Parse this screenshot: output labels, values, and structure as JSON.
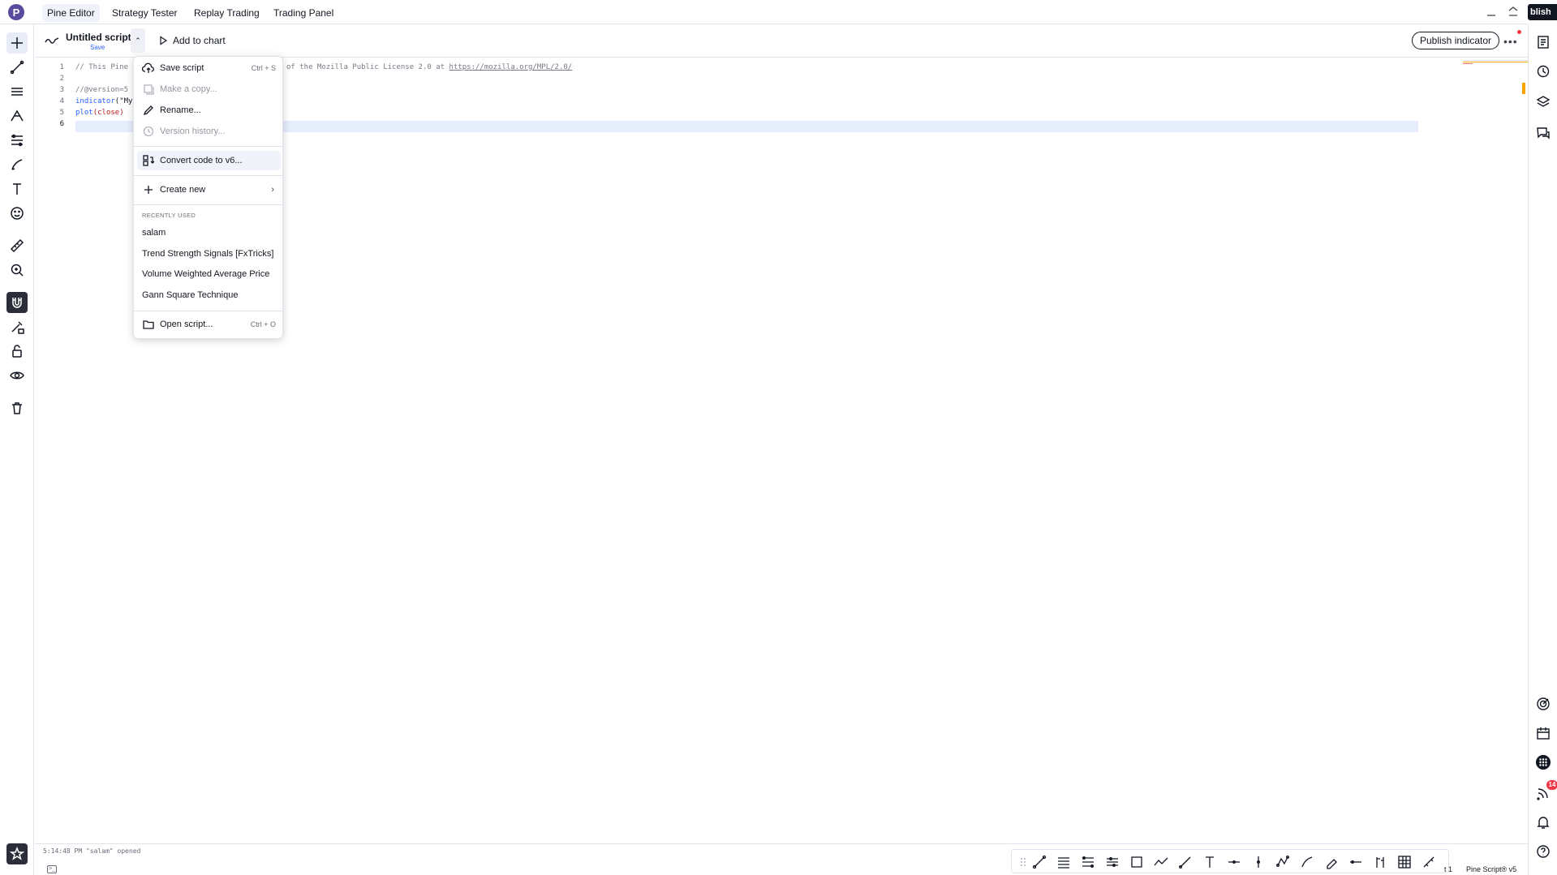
{
  "tabs": [
    {
      "label": "Pine Editor",
      "active": true
    },
    {
      "label": "Strategy Tester",
      "active": false
    },
    {
      "label": "Replay Trading",
      "active": false
    },
    {
      "label": "Trading Panel",
      "active": false
    }
  ],
  "logo_letter": "P",
  "script": {
    "title": "Untitled script",
    "save_link": "Save",
    "add_to_chart": "Add to chart",
    "publish_button": "Publish indicator",
    "publish_cut": "blish"
  },
  "editor": {
    "line_numbers": [
      "1",
      "2",
      "3",
      "4",
      "5",
      "6"
    ],
    "lines": [
      {
        "pre": "// This Pine S",
        "post": "of the Mozilla Public License 2.0 at ",
        "link": "https://mozilla.org/MPL/2.0/"
      },
      {
        "text": ""
      },
      {
        "text": "//@version=5"
      },
      {
        "fn": "indicator",
        "rest": "(\"My"
      },
      {
        "fn": "plot",
        "rest": "(close)"
      },
      {
        "text": ""
      }
    ]
  },
  "menu": {
    "items": [
      {
        "label": "Save script",
        "shortcut": "Ctrl + S",
        "icon": "cloud-upload-icon",
        "disabled": false
      },
      {
        "label": "Make a copy...",
        "shortcut": "",
        "icon": "copy-icon",
        "disabled": true
      },
      {
        "label": "Rename...",
        "shortcut": "",
        "icon": "pencil-icon",
        "disabled": false
      },
      {
        "label": "Version history...",
        "shortcut": "",
        "icon": "history-icon",
        "disabled": true
      }
    ],
    "convert": {
      "label": "Convert code to v6...",
      "icon": "convert-icon"
    },
    "create_new": {
      "label": "Create new",
      "icon": "plus-icon"
    },
    "recent_header": "RECENTLY USED",
    "recent": [
      "salam",
      "Trend Strength Signals [FxTricks]",
      "Volume Weighted Average Price",
      "Gann Square Technique"
    ],
    "open_script": {
      "label": "Open script...",
      "shortcut": "Ctrl + O",
      "icon": "folder-icon"
    }
  },
  "status": {
    "message": "5:14:48 PM  \"salam\" opened",
    "position": "t 1",
    "version": "Pine Script® v5"
  },
  "notifications_badge": "14",
  "colors": {
    "accent": "#2962ff",
    "alert": "#f23645",
    "logo": "#5b4b9e",
    "current_line": "#e6eefc"
  }
}
